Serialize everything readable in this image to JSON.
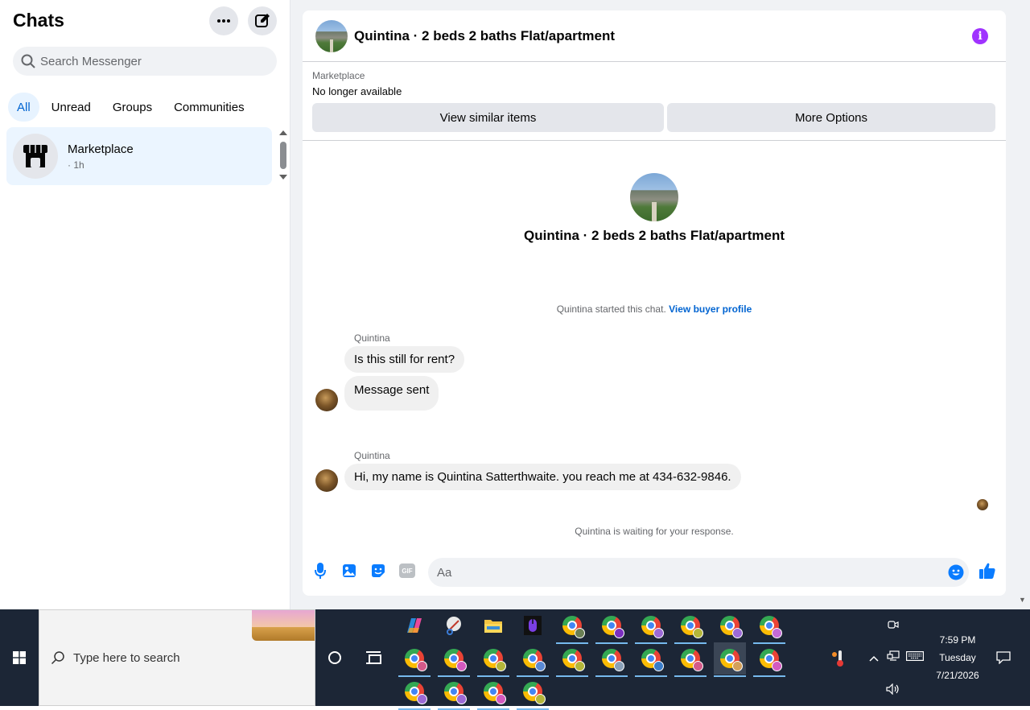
{
  "sidebar": {
    "title": "Chats",
    "search_placeholder": "Search Messenger",
    "filters": [
      "All",
      "Unread",
      "Groups",
      "Communities"
    ],
    "active_filter": "All",
    "chats": [
      {
        "name": "Marketplace",
        "time": "· 1h"
      }
    ]
  },
  "conversation": {
    "title": "Quintina · 2 beds 2 baths Flat/apartment",
    "marketplace_label": "Marketplace",
    "listing_status": "No longer available",
    "btn_similar": "View similar items",
    "btn_more": "More Options",
    "profile_title": "Quintina · 2 beds 2 baths Flat/apartment",
    "started_text": "Quintina started this chat.",
    "buyer_profile_link": "View buyer profile",
    "groups": [
      {
        "sender": "Quintina",
        "messages": [
          "Is this still for rent?",
          "Message sent"
        ]
      },
      {
        "sender": "Quintina",
        "messages": [
          "Hi, my name is Quintina Satterthwaite. you reach me at 434-632-9846."
        ]
      }
    ],
    "waiting_text": "Quintina is waiting for your response.",
    "composer_placeholder": "Aa",
    "gif_label": "GIF"
  },
  "taskbar": {
    "search_placeholder": "Type here to search",
    "time": "7:59 PM",
    "day": "Tuesday",
    "date": "7/21/2026"
  },
  "colors": {
    "accent": "#0064d1",
    "messenger_blue": "#0a7cff",
    "info_purple": "#a033ff",
    "taskbar": "#1c2636"
  }
}
